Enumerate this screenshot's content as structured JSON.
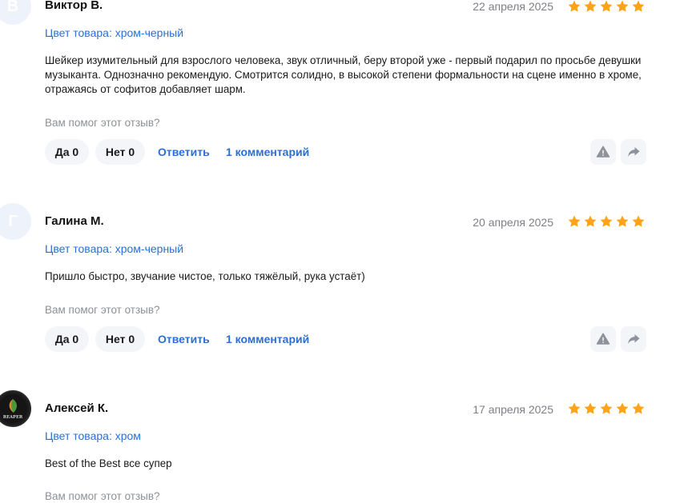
{
  "colors": {
    "accent": "#2a6fd6",
    "star": "#ffa31a",
    "muted": "#8d9096"
  },
  "reviews": [
    {
      "avatar_letter": "В",
      "author": "Виктор В.",
      "date": "22 апреля 2025",
      "rating": 5,
      "variant": "Цвет товара: хром-черный",
      "text": "Шейкер изумительный для взрослого человека, звук отличный, беру второй уже - первый подарил по просьбе девушки музыканта. Однозначно рекомендую. Смотрится солидно, в высокой степени формальности на сцене именно в хроме, отражаясь от софитов добавляет шарм.",
      "helpful_question": "Вам помог этот отзыв?",
      "yes_label": "Да 0",
      "no_label": "Нет 0",
      "reply_label": "Ответить",
      "comments_label": "1 комментарий"
    },
    {
      "avatar_letter": "Г",
      "author": "Галина М.",
      "date": "20 апреля 2025",
      "rating": 5,
      "variant": "Цвет товара: хром-черный",
      "text": "Пришло быстро, звучание чистое, только тяжёлый, рука устаёт)",
      "helpful_question": "Вам помог этот отзыв?",
      "yes_label": "Да 0",
      "no_label": "Нет 0",
      "reply_label": "Ответить",
      "comments_label": "1 комментарий"
    },
    {
      "avatar_logo": "REAPER",
      "author": "Алексей К.",
      "date": "17 апреля 2025",
      "rating": 5,
      "variant": "Цвет товара: хром",
      "text": "Best of the Best все супер",
      "helpful_question": "Вам помог этот отзыв?"
    }
  ]
}
